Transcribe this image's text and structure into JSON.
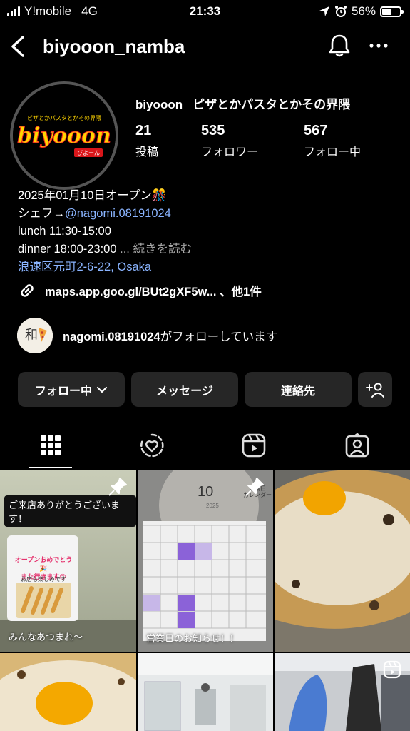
{
  "status_bar": {
    "carrier": "Y!mobile",
    "network": "4G",
    "time": "21:33",
    "battery_percent": "56%",
    "battery_level": 0.56
  },
  "header": {
    "username": "biyooon_namba"
  },
  "profile": {
    "avatar_logo_text": "biyooon",
    "avatar_tagline": "ピザとかパスタとかその界隈",
    "avatar_sub": "びよーん",
    "display_name": "biyooon",
    "category": "ピザとかパスタとかその界隈",
    "stats": [
      {
        "value": "21",
        "label": "投稿"
      },
      {
        "value": "535",
        "label": "フォロワー"
      },
      {
        "value": "567",
        "label": "フォロー中"
      }
    ]
  },
  "bio": {
    "line1": "2025年01月10日オープン🎊",
    "line2_prefix": "シェフ→",
    "line2_mention": "@nagomi.08191024",
    "line3": "lunch 11:30-15:00",
    "line4": "dinner 18:00-23:00",
    "more": "... 続きを読む",
    "address": "浪速区元町2-6-22, Osaka"
  },
  "link": {
    "text": "maps.app.goo.gl/BUt2gXF5w... 、他1件"
  },
  "followed_by": {
    "user": "nagomi.08191024",
    "suffix": "がフォローしています"
  },
  "actions": {
    "following": "フォロー中",
    "message": "メッセージ",
    "contact": "連絡先"
  },
  "tabs": [
    "grid-icon",
    "reposts-icon",
    "reels-icon",
    "tagged-icon"
  ],
  "posts": [
    {
      "caption": "みんなあつまれ〜",
      "banner": "ご来店ありがとうございます！",
      "story_text": "オープンおめでとう🎉\nまた行きます😊",
      "story_sub": "お店も楽しみです",
      "pinned": true
    },
    {
      "caption": "営業日のお知らせ！！",
      "calendar_month": "10",
      "calendar_year": "2025",
      "calendar_label": "営業日\nカレンダー",
      "pinned": true
    },
    {
      "caption": "",
      "pinned": false
    },
    {
      "caption": "",
      "pinned": false
    },
    {
      "caption": "",
      "pinned": false
    },
    {
      "caption": "",
      "pinned": false,
      "reel": true
    }
  ]
}
